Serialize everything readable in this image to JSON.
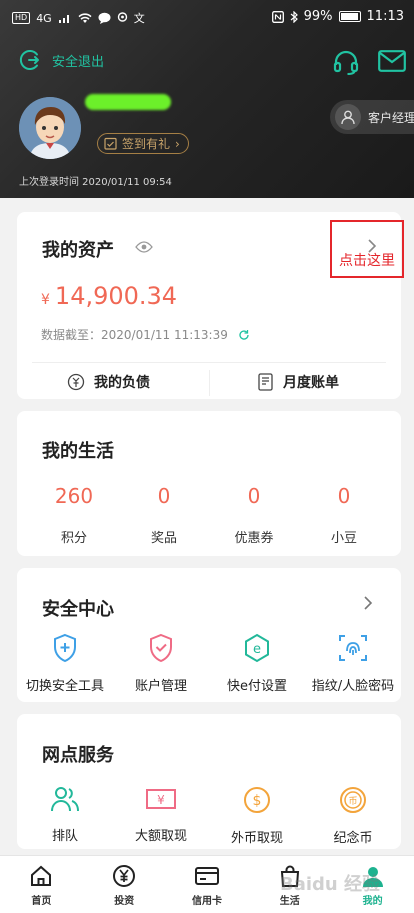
{
  "status_bar": {
    "network": "HD",
    "signal": "4G",
    "battery": "99%",
    "time": "11:13"
  },
  "header": {
    "logout_label": "安全退出",
    "signin_label": "签到有礼",
    "manager_label": "客户经理",
    "last_login": "上次登录时间 2020/01/11 09:54"
  },
  "assets": {
    "title": "我的资产",
    "currency": "¥",
    "amount": "14,900.34",
    "date_label": "数据截至：2020/01/11 11:13:39",
    "debt_label": "我的负债",
    "bill_label": "月度账单"
  },
  "annotation": "点击这里",
  "life": {
    "title": "我的生活",
    "stats": [
      {
        "value": "260",
        "label": "积分"
      },
      {
        "value": "0",
        "label": "奖品"
      },
      {
        "value": "0",
        "label": "优惠券"
      },
      {
        "value": "0",
        "label": "小豆"
      }
    ]
  },
  "security": {
    "title": "安全中心",
    "items": [
      {
        "label": "切换安全工具",
        "icon": "shield-plus-icon"
      },
      {
        "label": "账户管理",
        "icon": "shield-check-icon"
      },
      {
        "label": "快e付设置",
        "icon": "hexagon-e-icon"
      },
      {
        "label": "指纹/人脸密码",
        "icon": "fingerprint-icon"
      }
    ]
  },
  "branch": {
    "title": "网点服务",
    "items": [
      {
        "label": "排队",
        "icon": "queue-icon"
      },
      {
        "label": "大额取现",
        "icon": "cash-icon"
      },
      {
        "label": "外币取现",
        "icon": "dollar-coin-icon"
      },
      {
        "label": "纪念币",
        "icon": "commemorative-coin-icon"
      }
    ]
  },
  "tabbar": {
    "tabs": [
      {
        "label": "首页",
        "icon": "home-icon"
      },
      {
        "label": "投资",
        "icon": "yuan-icon"
      },
      {
        "label": "信用卡",
        "icon": "card-icon"
      },
      {
        "label": "生活",
        "icon": "bag-icon"
      },
      {
        "label": "我的",
        "icon": "user-icon"
      }
    ],
    "active": "我的"
  },
  "watermark": "Baidu 经验",
  "colors": {
    "accent": "#21c3a2",
    "amount": "#f06855",
    "gold": "#c9a46a",
    "annotation": "#e4262b"
  }
}
